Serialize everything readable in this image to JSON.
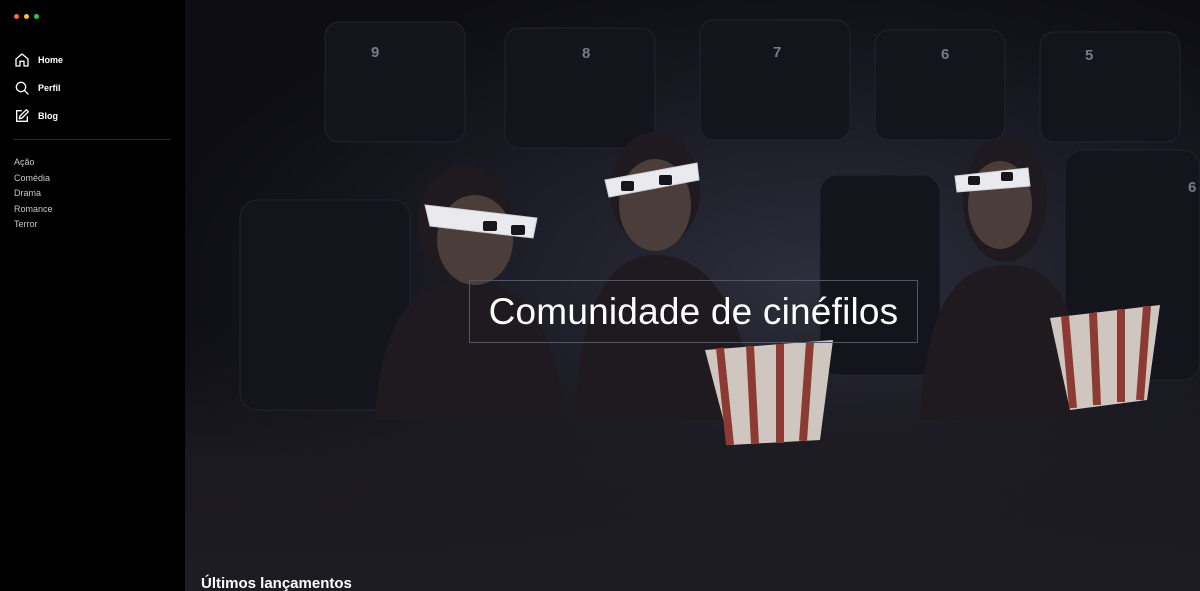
{
  "window": {
    "controls": [
      {
        "name": "close",
        "color": "#ff5f57"
      },
      {
        "name": "minimize",
        "color": "#febc2e"
      },
      {
        "name": "maximize",
        "color": "#28c840"
      }
    ]
  },
  "sidebar": {
    "nav": [
      {
        "label": "Home",
        "icon": "home-icon"
      },
      {
        "label": "Perfil",
        "icon": "search-icon"
      },
      {
        "label": "Blog",
        "icon": "edit-icon"
      }
    ],
    "genres": [
      "Ação",
      "Comédia",
      "Drama",
      "Romance",
      "Terror"
    ]
  },
  "hero": {
    "title": "Comunidade de cinéfilos",
    "seat_numbers": [
      "9",
      "8",
      "7",
      "6",
      "5",
      "6"
    ]
  },
  "sections": {
    "latest_title": "Últimos lançamentos"
  },
  "colors": {
    "sidebar_bg": "#000000",
    "main_bg": "#1d1c22",
    "title_border": "#4e5668"
  }
}
